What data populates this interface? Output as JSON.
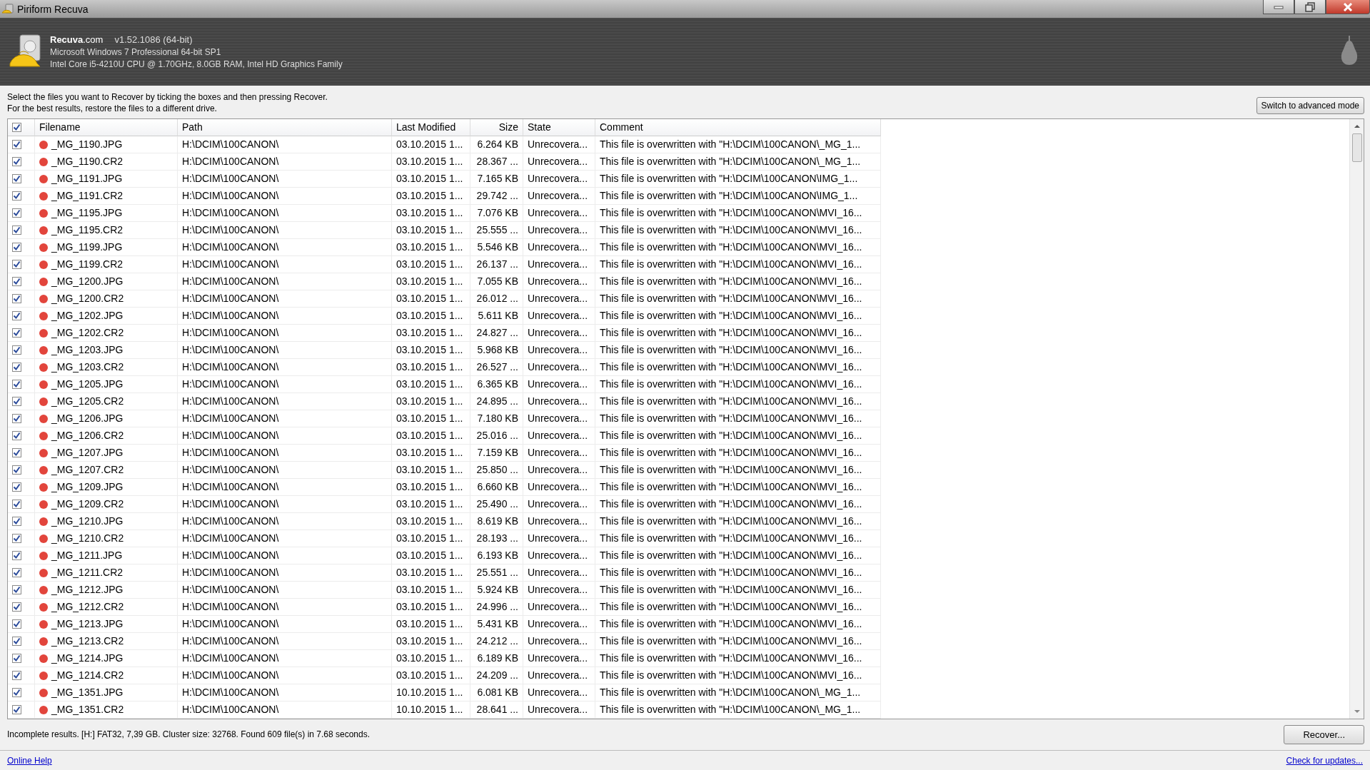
{
  "window": {
    "title": "Piriform Recuva"
  },
  "header": {
    "brand": "**Recuva**.com",
    "version": "v1.52.1086 (64-bit)",
    "os_info": "Microsoft Windows 7 Professional 64-bit SP1",
    "hardware_info": "Intel Core i5-4210U CPU @ 1.70GHz, 8.0GB RAM, Intel HD Graphics Family"
  },
  "instructions": [
    "Select the files you want to Recover by ticking the boxes and then pressing Recover.",
    "For the best results, restore the files to a different drive."
  ],
  "advanced_mode_button": "Switch to advanced mode",
  "table": {
    "select_all_checked": true,
    "columns": [
      "Filename",
      "Path",
      "Last Modified",
      "Size",
      "State",
      "Comment"
    ],
    "rows": [
      {
        "checked": true,
        "color": "#e2453c",
        "filename": "_MG_1190.JPG",
        "path": "H:\\DCIM\\100CANON\\",
        "last_modified": "03.10.2015 1...",
        "size": "6.264 KB",
        "state": "Unrecovera...",
        "comment": "This file is overwritten with \"H:\\DCIM\\100CANON\\_MG_1..."
      },
      {
        "checked": true,
        "color": "#e2453c",
        "filename": "_MG_1190.CR2",
        "path": "H:\\DCIM\\100CANON\\",
        "last_modified": "03.10.2015 1...",
        "size": "28.367 ...",
        "state": "Unrecovera...",
        "comment": "This file is overwritten with \"H:\\DCIM\\100CANON\\_MG_1..."
      },
      {
        "checked": true,
        "color": "#e2453c",
        "filename": "_MG_1191.JPG",
        "path": "H:\\DCIM\\100CANON\\",
        "last_modified": "03.10.2015 1...",
        "size": "7.165 KB",
        "state": "Unrecovera...",
        "comment": "This file is overwritten with \"H:\\DCIM\\100CANON\\IMG_1..."
      },
      {
        "checked": true,
        "color": "#e2453c",
        "filename": "_MG_1191.CR2",
        "path": "H:\\DCIM\\100CANON\\",
        "last_modified": "03.10.2015 1...",
        "size": "29.742 ...",
        "state": "Unrecovera...",
        "comment": "This file is overwritten with \"H:\\DCIM\\100CANON\\IMG_1..."
      },
      {
        "checked": true,
        "color": "#e2453c",
        "filename": "_MG_1195.JPG",
        "path": "H:\\DCIM\\100CANON\\",
        "last_modified": "03.10.2015 1...",
        "size": "7.076 KB",
        "state": "Unrecovera...",
        "comment": "This file is overwritten with \"H:\\DCIM\\100CANON\\MVI_16..."
      },
      {
        "checked": true,
        "color": "#e2453c",
        "filename": "_MG_1195.CR2",
        "path": "H:\\DCIM\\100CANON\\",
        "last_modified": "03.10.2015 1...",
        "size": "25.555 ...",
        "state": "Unrecovera...",
        "comment": "This file is overwritten with \"H:\\DCIM\\100CANON\\MVI_16..."
      },
      {
        "checked": true,
        "color": "#e2453c",
        "filename": "_MG_1199.JPG",
        "path": "H:\\DCIM\\100CANON\\",
        "last_modified": "03.10.2015 1...",
        "size": "5.546 KB",
        "state": "Unrecovera...",
        "comment": "This file is overwritten with \"H:\\DCIM\\100CANON\\MVI_16..."
      },
      {
        "checked": true,
        "color": "#e2453c",
        "filename": "_MG_1199.CR2",
        "path": "H:\\DCIM\\100CANON\\",
        "last_modified": "03.10.2015 1...",
        "size": "26.137 ...",
        "state": "Unrecovera...",
        "comment": "This file is overwritten with \"H:\\DCIM\\100CANON\\MVI_16..."
      },
      {
        "checked": true,
        "color": "#e2453c",
        "filename": "_MG_1200.JPG",
        "path": "H:\\DCIM\\100CANON\\",
        "last_modified": "03.10.2015 1...",
        "size": "7.055 KB",
        "state": "Unrecovera...",
        "comment": "This file is overwritten with \"H:\\DCIM\\100CANON\\MVI_16..."
      },
      {
        "checked": true,
        "color": "#e2453c",
        "filename": "_MG_1200.CR2",
        "path": "H:\\DCIM\\100CANON\\",
        "last_modified": "03.10.2015 1...",
        "size": "26.012 ...",
        "state": "Unrecovera...",
        "comment": "This file is overwritten with \"H:\\DCIM\\100CANON\\MVI_16..."
      },
      {
        "checked": true,
        "color": "#e2453c",
        "filename": "_MG_1202.JPG",
        "path": "H:\\DCIM\\100CANON\\",
        "last_modified": "03.10.2015 1...",
        "size": "5.611 KB",
        "state": "Unrecovera...",
        "comment": "This file is overwritten with \"H:\\DCIM\\100CANON\\MVI_16..."
      },
      {
        "checked": true,
        "color": "#e2453c",
        "filename": "_MG_1202.CR2",
        "path": "H:\\DCIM\\100CANON\\",
        "last_modified": "03.10.2015 1...",
        "size": "24.827 ...",
        "state": "Unrecovera...",
        "comment": "This file is overwritten with \"H:\\DCIM\\100CANON\\MVI_16..."
      },
      {
        "checked": true,
        "color": "#e2453c",
        "filename": "_MG_1203.JPG",
        "path": "H:\\DCIM\\100CANON\\",
        "last_modified": "03.10.2015 1...",
        "size": "5.968 KB",
        "state": "Unrecovera...",
        "comment": "This file is overwritten with \"H:\\DCIM\\100CANON\\MVI_16..."
      },
      {
        "checked": true,
        "color": "#e2453c",
        "filename": "_MG_1203.CR2",
        "path": "H:\\DCIM\\100CANON\\",
        "last_modified": "03.10.2015 1...",
        "size": "26.527 ...",
        "state": "Unrecovera...",
        "comment": "This file is overwritten with \"H:\\DCIM\\100CANON\\MVI_16..."
      },
      {
        "checked": true,
        "color": "#e2453c",
        "filename": "_MG_1205.JPG",
        "path": "H:\\DCIM\\100CANON\\",
        "last_modified": "03.10.2015 1...",
        "size": "6.365 KB",
        "state": "Unrecovera...",
        "comment": "This file is overwritten with \"H:\\DCIM\\100CANON\\MVI_16..."
      },
      {
        "checked": true,
        "color": "#e2453c",
        "filename": "_MG_1205.CR2",
        "path": "H:\\DCIM\\100CANON\\",
        "last_modified": "03.10.2015 1...",
        "size": "24.895 ...",
        "state": "Unrecovera...",
        "comment": "This file is overwritten with \"H:\\DCIM\\100CANON\\MVI_16..."
      },
      {
        "checked": true,
        "color": "#e2453c",
        "filename": "_MG_1206.JPG",
        "path": "H:\\DCIM\\100CANON\\",
        "last_modified": "03.10.2015 1...",
        "size": "7.180 KB",
        "state": "Unrecovera...",
        "comment": "This file is overwritten with \"H:\\DCIM\\100CANON\\MVI_16..."
      },
      {
        "checked": true,
        "color": "#e2453c",
        "filename": "_MG_1206.CR2",
        "path": "H:\\DCIM\\100CANON\\",
        "last_modified": "03.10.2015 1...",
        "size": "25.016 ...",
        "state": "Unrecovera...",
        "comment": "This file is overwritten with \"H:\\DCIM\\100CANON\\MVI_16..."
      },
      {
        "checked": true,
        "color": "#e2453c",
        "filename": "_MG_1207.JPG",
        "path": "H:\\DCIM\\100CANON\\",
        "last_modified": "03.10.2015 1...",
        "size": "7.159 KB",
        "state": "Unrecovera...",
        "comment": "This file is overwritten with \"H:\\DCIM\\100CANON\\MVI_16..."
      },
      {
        "checked": true,
        "color": "#e2453c",
        "filename": "_MG_1207.CR2",
        "path": "H:\\DCIM\\100CANON\\",
        "last_modified": "03.10.2015 1...",
        "size": "25.850 ...",
        "state": "Unrecovera...",
        "comment": "This file is overwritten with \"H:\\DCIM\\100CANON\\MVI_16..."
      },
      {
        "checked": true,
        "color": "#e2453c",
        "filename": "_MG_1209.JPG",
        "path": "H:\\DCIM\\100CANON\\",
        "last_modified": "03.10.2015 1...",
        "size": "6.660 KB",
        "state": "Unrecovera...",
        "comment": "This file is overwritten with \"H:\\DCIM\\100CANON\\MVI_16..."
      },
      {
        "checked": true,
        "color": "#e2453c",
        "filename": "_MG_1209.CR2",
        "path": "H:\\DCIM\\100CANON\\",
        "last_modified": "03.10.2015 1...",
        "size": "25.490 ...",
        "state": "Unrecovera...",
        "comment": "This file is overwritten with \"H:\\DCIM\\100CANON\\MVI_16..."
      },
      {
        "checked": true,
        "color": "#e2453c",
        "filename": "_MG_1210.JPG",
        "path": "H:\\DCIM\\100CANON\\",
        "last_modified": "03.10.2015 1...",
        "size": "8.619 KB",
        "state": "Unrecovera...",
        "comment": "This file is overwritten with \"H:\\DCIM\\100CANON\\MVI_16..."
      },
      {
        "checked": true,
        "color": "#e2453c",
        "filename": "_MG_1210.CR2",
        "path": "H:\\DCIM\\100CANON\\",
        "last_modified": "03.10.2015 1...",
        "size": "28.193 ...",
        "state": "Unrecovera...",
        "comment": "This file is overwritten with \"H:\\DCIM\\100CANON\\MVI_16..."
      },
      {
        "checked": true,
        "color": "#e2453c",
        "filename": "_MG_1211.JPG",
        "path": "H:\\DCIM\\100CANON\\",
        "last_modified": "03.10.2015 1...",
        "size": "6.193 KB",
        "state": "Unrecovera...",
        "comment": "This file is overwritten with \"H:\\DCIM\\100CANON\\MVI_16..."
      },
      {
        "checked": true,
        "color": "#e2453c",
        "filename": "_MG_1211.CR2",
        "path": "H:\\DCIM\\100CANON\\",
        "last_modified": "03.10.2015 1...",
        "size": "25.551 ...",
        "state": "Unrecovera...",
        "comment": "This file is overwritten with \"H:\\DCIM\\100CANON\\MVI_16..."
      },
      {
        "checked": true,
        "color": "#e2453c",
        "filename": "_MG_1212.JPG",
        "path": "H:\\DCIM\\100CANON\\",
        "last_modified": "03.10.2015 1...",
        "size": "5.924 KB",
        "state": "Unrecovera...",
        "comment": "This file is overwritten with \"H:\\DCIM\\100CANON\\MVI_16..."
      },
      {
        "checked": true,
        "color": "#e2453c",
        "filename": "_MG_1212.CR2",
        "path": "H:\\DCIM\\100CANON\\",
        "last_modified": "03.10.2015 1...",
        "size": "24.996 ...",
        "state": "Unrecovera...",
        "comment": "This file is overwritten with \"H:\\DCIM\\100CANON\\MVI_16..."
      },
      {
        "checked": true,
        "color": "#e2453c",
        "filename": "_MG_1213.JPG",
        "path": "H:\\DCIM\\100CANON\\",
        "last_modified": "03.10.2015 1...",
        "size": "5.431 KB",
        "state": "Unrecovera...",
        "comment": "This file is overwritten with \"H:\\DCIM\\100CANON\\MVI_16..."
      },
      {
        "checked": true,
        "color": "#e2453c",
        "filename": "_MG_1213.CR2",
        "path": "H:\\DCIM\\100CANON\\",
        "last_modified": "03.10.2015 1...",
        "size": "24.212 ...",
        "state": "Unrecovera...",
        "comment": "This file is overwritten with \"H:\\DCIM\\100CANON\\MVI_16..."
      },
      {
        "checked": true,
        "color": "#e2453c",
        "filename": "_MG_1214.JPG",
        "path": "H:\\DCIM\\100CANON\\",
        "last_modified": "03.10.2015 1...",
        "size": "6.189 KB",
        "state": "Unrecovera...",
        "comment": "This file is overwritten with \"H:\\DCIM\\100CANON\\MVI_16..."
      },
      {
        "checked": true,
        "color": "#e2453c",
        "filename": "_MG_1214.CR2",
        "path": "H:\\DCIM\\100CANON\\",
        "last_modified": "03.10.2015 1...",
        "size": "24.209 ...",
        "state": "Unrecovera...",
        "comment": "This file is overwritten with \"H:\\DCIM\\100CANON\\MVI_16..."
      },
      {
        "checked": true,
        "color": "#e2453c",
        "filename": "_MG_1351.JPG",
        "path": "H:\\DCIM\\100CANON\\",
        "last_modified": "10.10.2015 1...",
        "size": "6.081 KB",
        "state": "Unrecovera...",
        "comment": "This file is overwritten with \"H:\\DCIM\\100CANON\\_MG_1..."
      },
      {
        "checked": true,
        "color": "#e2453c",
        "filename": "_MG_1351.CR2",
        "path": "H:\\DCIM\\100CANON\\",
        "last_modified": "10.10.2015 1...",
        "size": "28.641 ...",
        "state": "Unrecovera...",
        "comment": "This file is overwritten with \"H:\\DCIM\\100CANON\\_MG_1..."
      }
    ]
  },
  "status_text": "Incomplete results. [H:] FAT32, 7,39 GB. Cluster size: 32768. Found 609 file(s) in 7.68 seconds.",
  "recover_button": "Recover...",
  "footer": {
    "online_help": "Online Help",
    "check_updates": "Check for updates..."
  }
}
